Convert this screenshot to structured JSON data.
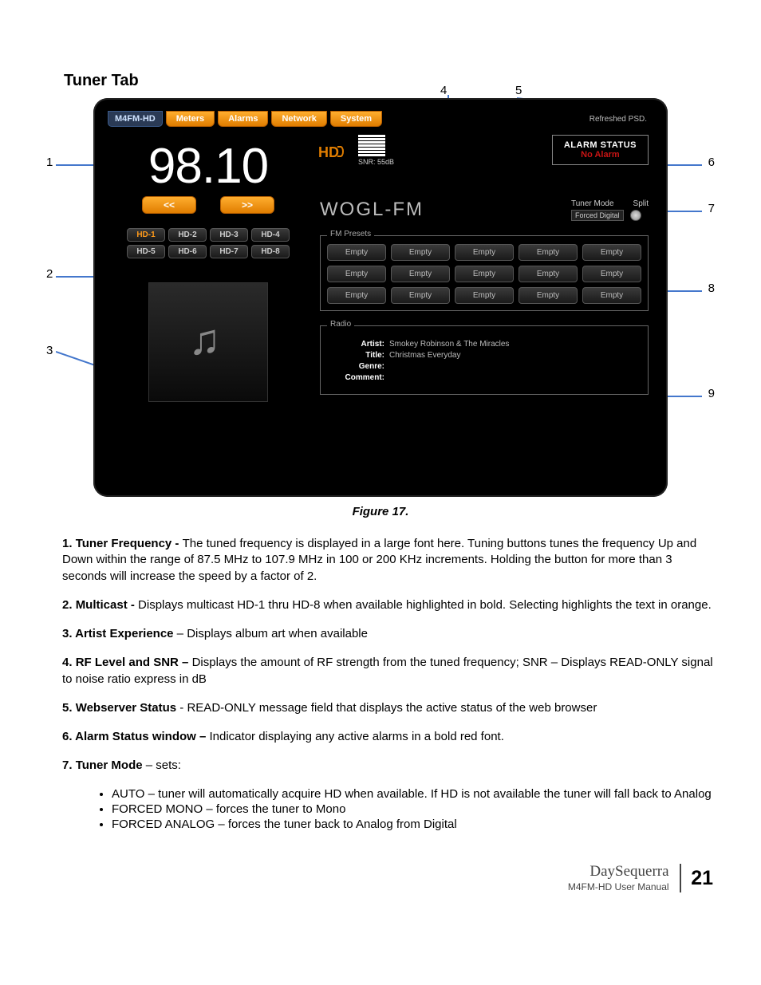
{
  "page": {
    "heading": "Tuner Tab",
    "figure_caption": "Figure 17."
  },
  "tabs": {
    "brand": "M4FM-HD",
    "items": [
      "Meters",
      "Alarms",
      "Network",
      "System"
    ],
    "webserver_status": "Refreshed PSD."
  },
  "tuner": {
    "frequency": "98.10",
    "btn_down": "<<",
    "btn_up": ">>",
    "hd_channels": [
      "HD-1",
      "HD-2",
      "HD-3",
      "HD-4",
      "HD-5",
      "HD-6",
      "HD-7",
      "HD-8"
    ],
    "active_hd_index": 0,
    "station": "WOGL-FM",
    "snr_label": "SNR: 55dB",
    "hd_logo_text": "HD"
  },
  "alarm": {
    "title": "ALARM STATUS",
    "message": "No Alarm"
  },
  "mode": {
    "label_tuner_mode": "Tuner Mode",
    "label_split": "Split",
    "selected": "Forced Digital"
  },
  "presets": {
    "legend": "FM Presets",
    "slots": [
      "Empty",
      "Empty",
      "Empty",
      "Empty",
      "Empty",
      "Empty",
      "Empty",
      "Empty",
      "Empty",
      "Empty",
      "Empty",
      "Empty",
      "Empty",
      "Empty",
      "Empty"
    ]
  },
  "radio": {
    "legend": "Radio",
    "artist_label": "Artist:",
    "artist": "Smokey Robinson & The Miracles",
    "title_label": "Title:",
    "title": "Christmas Everyday",
    "genre_label": "Genre:",
    "genre": "",
    "comment_label": "Comment:",
    "comment": ""
  },
  "annotations": {
    "n1": "1",
    "n2": "2",
    "n3": "3",
    "n4": "4",
    "n5": "5",
    "n6": "6",
    "n7": "7",
    "n8": "8",
    "n9": "9"
  },
  "descriptions": [
    {
      "num": "1.",
      "term": "Tuner Frequency - ",
      "body": "The tuned frequency is displayed in a large font here.  Tuning buttons tunes the frequency Up and Down within the range of 87.5 MHz to 107.9 MHz in 100 or 200 KHz increments.  Holding the button for more than 3 seconds will increase the speed by a factor of 2."
    },
    {
      "num": "2.",
      "term": "Multicast - ",
      "body": "Displays multicast HD-1 thru HD-8 when available highlighted in bold.  Selecting highlights the text in orange."
    },
    {
      "num": "3.",
      "term": "Artist Experience",
      "body": " – Displays album art when available"
    },
    {
      "num": "4.",
      "term": "RF Level and SNR – ",
      "body": "Displays the amount of RF strength from the tuned frequency; SNR – Displays READ-ONLY signal to noise ratio express in dB"
    },
    {
      "num": "5.",
      "term": " Webserver Status",
      "body": " - READ-ONLY message field that displays the active status of the web browser"
    },
    {
      "num": "6.",
      "term": "Alarm Status window – ",
      "body": "Indicator displaying any active alarms in a bold red font."
    },
    {
      "num": "7.",
      "term": "Tuner Mode",
      "body": " – sets:"
    }
  ],
  "mode_sub": [
    "AUTO – tuner will automatically acquire HD when available.  If HD is not available the tuner will fall back to Analog",
    "FORCED MONO – forces the tuner to Mono",
    "FORCED ANALOG – forces the tuner back to Analog from Digital"
  ],
  "footer": {
    "brand": "DaySequerra",
    "subtitle": "M4FM-HD User Manual",
    "page_number": "21"
  }
}
